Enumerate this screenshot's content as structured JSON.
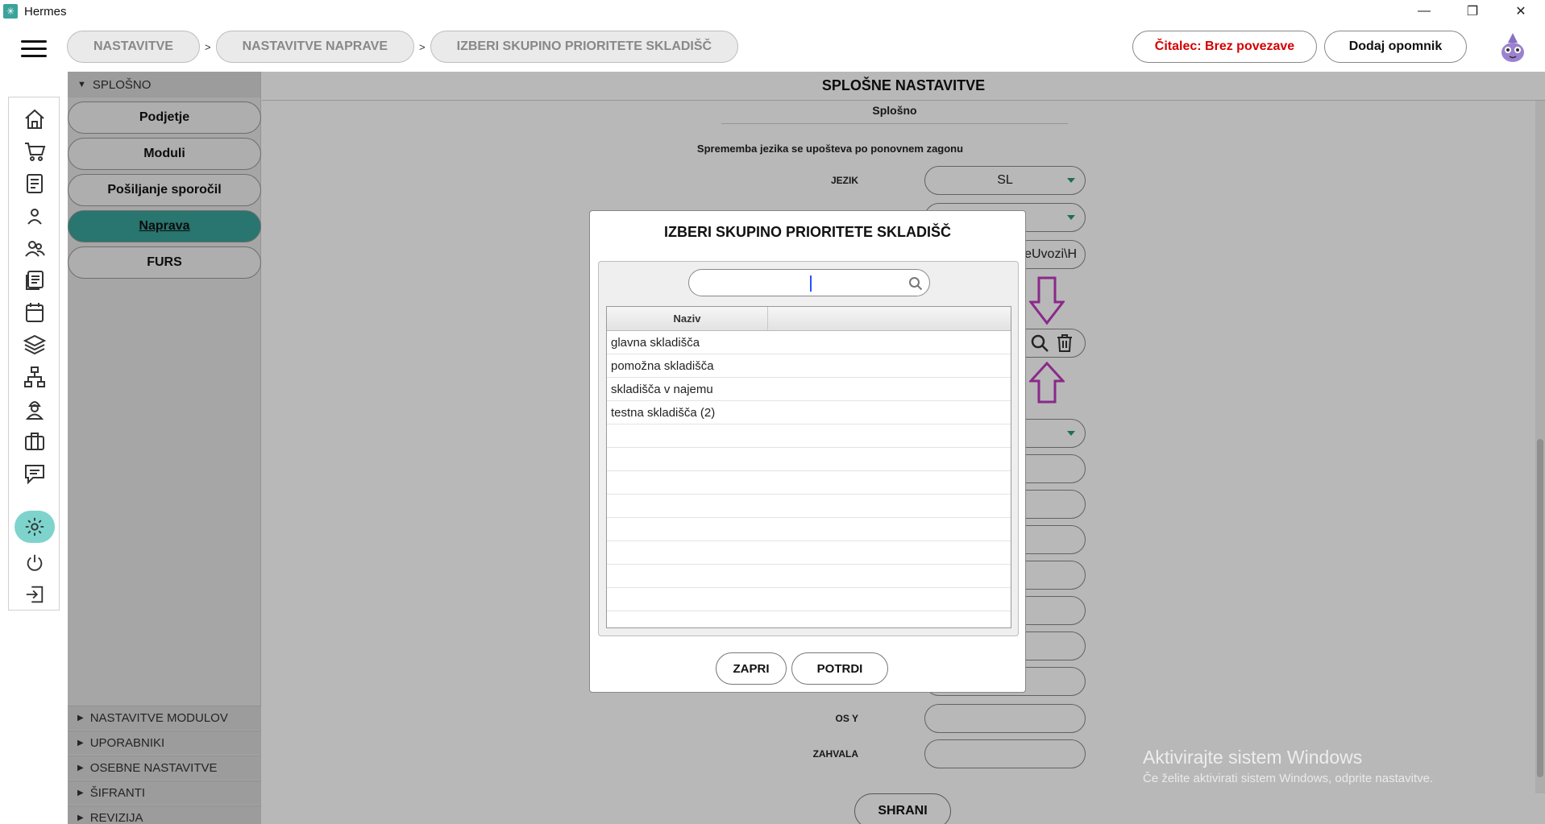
{
  "window": {
    "title": "Hermes",
    "controls": [
      "minimize-icon",
      "restore-icon",
      "close-icon"
    ]
  },
  "header": {
    "breadcrumbs": [
      "NASTAVITVE",
      "NASTAVITVE NAPRAVE",
      "IZBERI SKUPINO PRIORITETE SKLADIŠČ"
    ],
    "separator": ">",
    "reader_status": "Čitalec: Brez povezave",
    "reminder_button": "Dodaj opomnik"
  },
  "rail": {
    "items": [
      "home-icon",
      "cart-icon",
      "document-icon",
      "user-icon",
      "users-icon",
      "list-icon",
      "calendar-icon",
      "layers-icon",
      "network-icon",
      "worker-icon",
      "briefcase-icon",
      "message-icon",
      "settings-icon",
      "power-icon",
      "logout-icon"
    ],
    "active": "settings-icon"
  },
  "sidebar": {
    "group": "SPLOŠNO",
    "items": [
      "Podjetje",
      "Moduli",
      "Pošiljanje sporočil",
      "Naprava",
      "FURS"
    ],
    "active": "Naprava",
    "sections": [
      "NASTAVITVE MODULOV",
      "UPORABNIKI",
      "OSEBNE NASTAVITVE",
      "ŠIFRANTI",
      "REVIZIJA"
    ]
  },
  "main": {
    "title": "SPLOŠNE NASTAVITVE",
    "section": "Splošno",
    "note": "Sprememba jezika se upošteva po ponovnem zagonu",
    "fields": {
      "language_label": "JEZIK",
      "language_value": "SL",
      "path_value": "ekeUvozi\\H",
      "osy_label": "OS Y",
      "thanks_label": "ZAHVALA"
    },
    "save_button": "SHRANI"
  },
  "modal": {
    "title": "IZBERI SKUPINO PRIORITETE SKLADIŠČ",
    "search": {
      "value": "",
      "placeholder": ""
    },
    "column_header": "Naziv",
    "rows": [
      "glavna skladišča",
      "pomožna skladišča",
      "skladišča v najemu",
      "testna skladišča (2)"
    ],
    "close_button": "ZAPRI",
    "confirm_button": "POTRDI"
  },
  "watermark": {
    "line1": "Aktivirajte sistem Windows",
    "line2": "Če želite aktivirati sistem Windows, odprite nastavitve."
  },
  "colors": {
    "accent": "#3aa39a",
    "accent_light": "#7ed3cd",
    "status_red": "#d40000",
    "annotation_arrow": "#c03ac0"
  }
}
